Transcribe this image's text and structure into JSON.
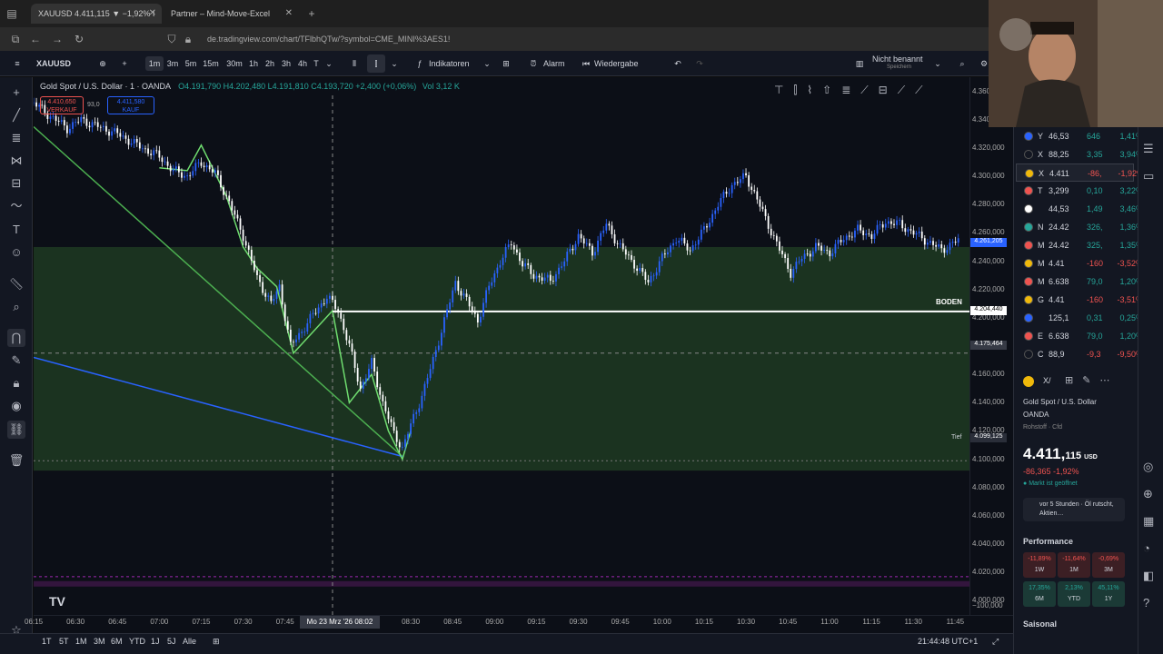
{
  "browser": {
    "tabs": [
      {
        "label": "XAUUSD 4.411,115 ▼ −1,92% I"
      },
      {
        "label": "Partner – Mind-Move-Excel"
      }
    ],
    "url": "de.tradingview.com/chart/TFlbhQTw/?symbol=CME_MINI%3AES1!"
  },
  "toolbar": {
    "symbol": "XAUUSD",
    "timeframes": [
      "1m",
      "3m",
      "5m",
      "15m",
      "30m",
      "1h",
      "2h",
      "3h",
      "4h",
      "T"
    ],
    "active_timeframe": "1m",
    "indicators_label": "Indikatoren",
    "alarm_label": "Alarm",
    "replay_label": "Wiedergabe",
    "layout_name": "Nicht benannt",
    "layout_status": "Speichern"
  },
  "legend": {
    "title": "Gold Spot / U.S. Dollar · 1 · OANDA",
    "ohlc": "O4.191,790 H4.202,480 L4.191,810 C4.193,720 +2,400 (+0,06%)",
    "volume": "Vol 3,12 K",
    "sell_price": "4.410,650",
    "sell_label": "VERKAUF",
    "spread": "93,0",
    "buy_price": "4.411,580",
    "buy_label": "KAUF"
  },
  "chart_data": {
    "type": "candlestick",
    "instrument": "Gold Spot / U.S. Dollar",
    "interval": "1",
    "x_ticks": [
      "06:15",
      "06:30",
      "06:45",
      "07:00",
      "07:15",
      "07:30",
      "07:45",
      "08:02",
      "08:15",
      "08:30",
      "08:45",
      "09:00",
      "09:15",
      "09:30",
      "09:45",
      "10:00",
      "10:15",
      "10:30",
      "10:45",
      "11:00",
      "11:15",
      "11:30",
      "11:45"
    ],
    "crosshair_time": "Mo 23 Mrz '26  08:02",
    "y_ticks": [
      "4.360,000",
      "4.340,000",
      "4.320,000",
      "4.300,000",
      "4.280,000",
      "4.260,000",
      "4.240,000",
      "4.220,000",
      "4.200,000",
      "4.180,000",
      "4.160,000",
      "4.140,000",
      "4.120,000",
      "4.100,000",
      "4.080,000",
      "4.060,000",
      "4.040,000",
      "4.020,000",
      "4.000,000",
      "−100,000"
    ],
    "ylim": [
      3990,
      4370
    ],
    "zone": {
      "top": 4250,
      "bottom": 4092
    },
    "close_path": [
      [
        "06:15",
        4352
      ],
      [
        "06:20",
        4344
      ],
      [
        "06:27",
        4334
      ],
      [
        "06:32",
        4340
      ],
      [
        "06:37",
        4336
      ],
      [
        "06:45",
        4330
      ],
      [
        "06:52",
        4322
      ],
      [
        "07:00",
        4314
      ],
      [
        "07:05",
        4304
      ],
      [
        "07:10",
        4300
      ],
      [
        "07:15",
        4310
      ],
      [
        "07:20",
        4302
      ],
      [
        "07:24",
        4286
      ],
      [
        "07:30",
        4258
      ],
      [
        "07:35",
        4228
      ],
      [
        "07:40",
        4210
      ],
      [
        "07:43",
        4222
      ],
      [
        "07:47",
        4180
      ],
      [
        "07:50",
        4188
      ],
      [
        "07:55",
        4202
      ],
      [
        "08:00",
        4215
      ],
      [
        "08:04",
        4205
      ],
      [
        "08:08",
        4180
      ],
      [
        "08:12",
        4150
      ],
      [
        "08:16",
        4168
      ],
      [
        "08:20",
        4140
      ],
      [
        "08:24",
        4118
      ],
      [
        "08:27",
        4108
      ],
      [
        "08:30",
        4124
      ],
      [
        "08:34",
        4145
      ],
      [
        "08:38",
        4170
      ],
      [
        "08:42",
        4198
      ],
      [
        "08:46",
        4225
      ],
      [
        "08:50",
        4212
      ],
      [
        "08:54",
        4198
      ],
      [
        "08:58",
        4222
      ],
      [
        "09:02",
        4240
      ],
      [
        "09:06",
        4253
      ],
      [
        "09:10",
        4238
      ],
      [
        "09:14",
        4230
      ],
      [
        "09:20",
        4226
      ],
      [
        "09:25",
        4240
      ],
      [
        "09:30",
        4258
      ],
      [
        "09:35",
        4246
      ],
      [
        "09:40",
        4266
      ],
      [
        "09:45",
        4250
      ],
      [
        "09:50",
        4238
      ],
      [
        "09:55",
        4225
      ],
      [
        "10:00",
        4242
      ],
      [
        "10:05",
        4256
      ],
      [
        "10:10",
        4248
      ],
      [
        "10:15",
        4262
      ],
      [
        "10:20",
        4280
      ],
      [
        "10:25",
        4294
      ],
      [
        "10:30",
        4300
      ],
      [
        "10:33",
        4288
      ],
      [
        "10:37",
        4270
      ],
      [
        "10:42",
        4248
      ],
      [
        "10:46",
        4232
      ],
      [
        "10:50",
        4242
      ],
      [
        "10:55",
        4250
      ],
      [
        "11:00",
        4246
      ],
      [
        "11:05",
        4256
      ],
      [
        "11:10",
        4262
      ],
      [
        "11:15",
        4258
      ],
      [
        "11:20",
        4268
      ],
      [
        "11:25",
        4266
      ],
      [
        "11:30",
        4260
      ],
      [
        "11:35",
        4254
      ],
      [
        "11:40",
        4248
      ],
      [
        "11:47",
        4256
      ]
    ],
    "annotations": [
      {
        "label": "BODEN",
        "price": 4204.44
      },
      {
        "label": "Tief",
        "price": 4099.125
      }
    ],
    "price_tags": [
      "4.261,205",
      "4.204,440",
      "4.175,464",
      "4.099,125"
    ]
  },
  "watchlist": [
    {
      "sym": "Y",
      "last": "46,53",
      "chg": "646",
      "pct": "1,41%",
      "dir": "up",
      "color": "#2962ff"
    },
    {
      "sym": "X",
      "last": "88,25",
      "chg": "3,35",
      "pct": "3,94%",
      "dir": "up",
      "color": "#131722"
    },
    {
      "sym": "X",
      "last": "4.411",
      "chg": "-86,",
      "pct": "-1,92%",
      "dir": "down",
      "color": "#f0b90b"
    },
    {
      "sym": "T",
      "last": "3,299",
      "chg": "0,10",
      "pct": "3,22%",
      "dir": "up",
      "color": "#ef5350"
    },
    {
      "sym": "",
      "last": "44,53",
      "chg": "1,49",
      "pct": "3,46%",
      "dir": "up",
      "color": "#ffffff"
    },
    {
      "sym": "N",
      "last": "24.42",
      "chg": "326,",
      "pct": "1,36%",
      "dir": "up",
      "color": "#26a69a"
    },
    {
      "sym": "M",
      "last": "24.42",
      "chg": "325,",
      "pct": "1,35%",
      "dir": "up",
      "color": "#ef5350"
    },
    {
      "sym": "M",
      "last": "4.41",
      "chg": "-160",
      "pct": "-3,52%",
      "dir": "down",
      "color": "#f0b90b"
    },
    {
      "sym": "M",
      "last": "6.638",
      "chg": "79,0",
      "pct": "1,20%",
      "dir": "up",
      "color": "#ef5350"
    },
    {
      "sym": "G",
      "last": "4.41",
      "chg": "-160",
      "pct": "-3,51%",
      "dir": "down",
      "color": "#f0b90b"
    },
    {
      "sym": "",
      "last": "125,1",
      "chg": "0,31",
      "pct": "0,25%",
      "dir": "up",
      "color": "#2962ff"
    },
    {
      "sym": "E",
      "last": "6.638",
      "chg": "79,0",
      "pct": "1,20%",
      "dir": "up",
      "color": "#ef5350"
    },
    {
      "sym": "C",
      "last": "88,9",
      "chg": "-9,3",
      "pct": "-9,50%",
      "dir": "down",
      "color": "#131722"
    }
  ],
  "details": {
    "sym_short": "X/",
    "name": "Gold Spot / U.S. Dollar",
    "exchange": "OANDA",
    "category": "Rohstoff · Cfd",
    "price_main": "4.411,",
    "price_small": "115",
    "currency": "USD",
    "change": "-86,365  -1,92%",
    "market_status": "Markt ist geöffnet",
    "news": "vor 5 Stunden · Öl rutscht, Aktien…",
    "performance_title": "Performance",
    "performance": [
      {
        "v": "-11,89%",
        "p": "1W",
        "dir": "down"
      },
      {
        "v": "-11,64%",
        "p": "1M",
        "dir": "down"
      },
      {
        "v": "-0,69%",
        "p": "3M",
        "dir": "down"
      },
      {
        "v": "17,35%",
        "p": "6M",
        "dir": "up"
      },
      {
        "v": "2,13%",
        "p": "YTD",
        "dir": "up"
      },
      {
        "v": "45,11%",
        "p": "1Y",
        "dir": "up"
      }
    ],
    "seasonal_title": "Saisonal"
  },
  "bottom": {
    "ranges": [
      "1T",
      "5T",
      "1M",
      "3M",
      "6M",
      "YTD",
      "1J",
      "5J",
      "Alle"
    ],
    "clock": "21:44:48 UTC+1"
  },
  "colors": {
    "up": "#2962ff",
    "down": "#ffffff",
    "zone": "#1e3a22",
    "trend_green": "#4caf50",
    "trend_blue": "#2962ff"
  }
}
